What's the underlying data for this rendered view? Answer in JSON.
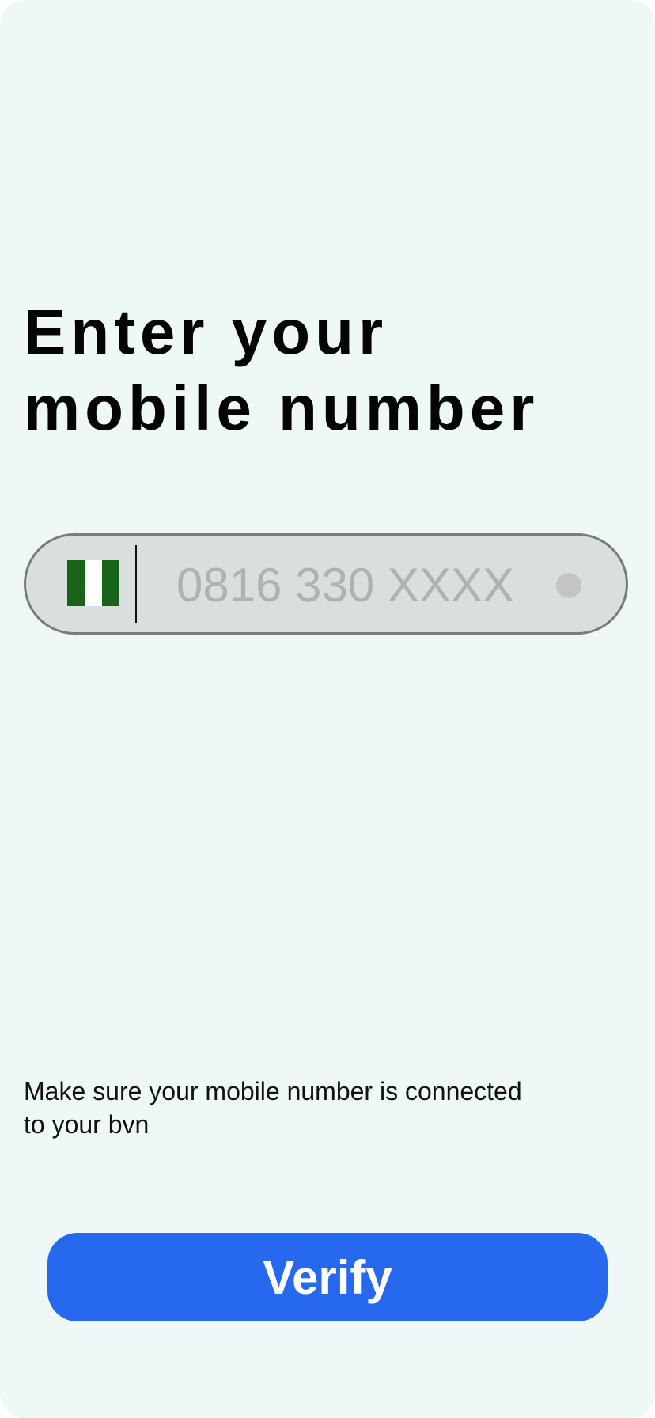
{
  "header": {
    "title_line1": "Enter your",
    "title_line2": "mobile number"
  },
  "phone_field": {
    "country_flag_icon": "nigeria-flag-icon",
    "value": "",
    "placeholder": "0816 330 XXXX",
    "status_indicator_icon": "status-dot-icon"
  },
  "hint": {
    "text_line1": "Make sure your mobile number is connected",
    "text_line2": "to your bvn"
  },
  "actions": {
    "verify_label": "Verify"
  },
  "colors": {
    "background": "#edf8f7",
    "accent": "#2669ef",
    "field_background": "#d9dede",
    "flag_green": "#176317"
  }
}
